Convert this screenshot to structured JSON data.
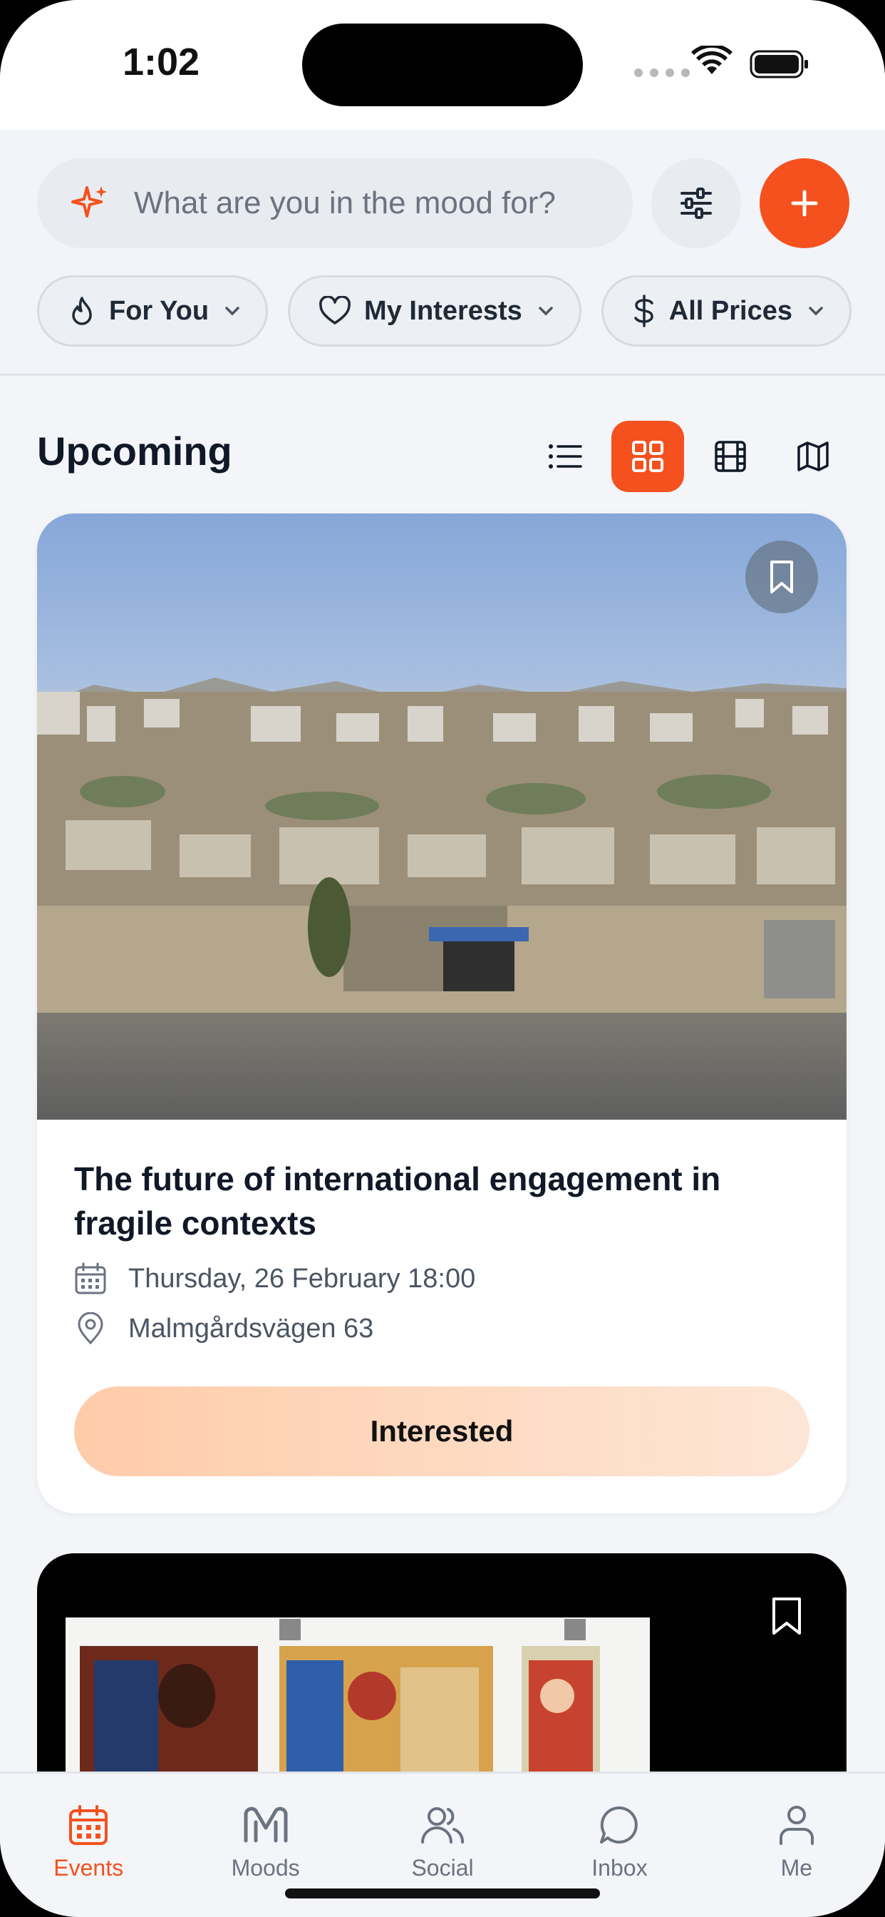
{
  "status_bar": {
    "time": "1:02"
  },
  "search": {
    "placeholder": "What are you in the mood for?"
  },
  "filters": [
    {
      "label": "For You",
      "icon": "flame-icon"
    },
    {
      "label": "My Interests",
      "icon": "heart-icon"
    },
    {
      "label": "All Prices",
      "icon": "dollar-icon"
    }
  ],
  "section": {
    "title": "Upcoming",
    "view_modes": [
      {
        "name": "list-view",
        "active": false
      },
      {
        "name": "grid-view",
        "active": true
      },
      {
        "name": "film-view",
        "active": false
      },
      {
        "name": "map-view",
        "active": false
      }
    ]
  },
  "events": [
    {
      "title": "The future of international engagement in fragile contexts",
      "date": "Thursday, 26 February 18:00",
      "location": "Malmgårdsvägen 63",
      "action_label": "Interested"
    }
  ],
  "tabs": [
    {
      "label": "Events",
      "icon": "calendar-icon",
      "active": true
    },
    {
      "label": "Moods",
      "icon": "moods-icon",
      "active": false
    },
    {
      "label": "Social",
      "icon": "users-icon",
      "active": false
    },
    {
      "label": "Inbox",
      "icon": "chat-icon",
      "active": false
    },
    {
      "label": "Me",
      "icon": "user-icon",
      "active": false
    }
  ],
  "colors": {
    "accent": "#f4511e",
    "interested_button": "#ffccaa"
  }
}
